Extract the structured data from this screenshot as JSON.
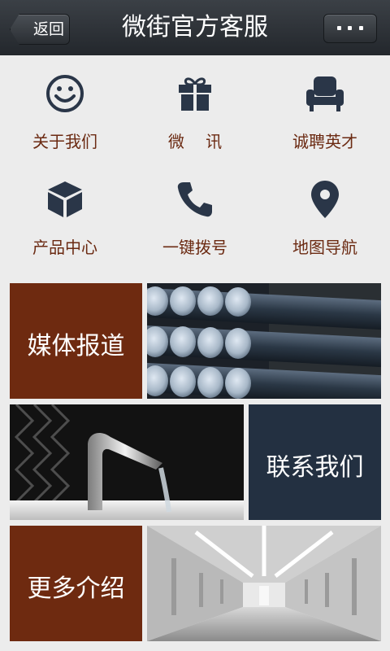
{
  "header": {
    "back_label": "返回",
    "title": "微街官方客服",
    "menu_icon": "more-dots-icon"
  },
  "grid": {
    "items": [
      {
        "label": "关于我们",
        "icon": "smiley-icon"
      },
      {
        "label": "微　 讯",
        "icon": "gift-icon"
      },
      {
        "label": "诚聘英才",
        "icon": "armchair-icon"
      },
      {
        "label": "产品中心",
        "icon": "cube-icon"
      },
      {
        "label": "一键拨号",
        "icon": "phone-icon"
      },
      {
        "label": "地图导航",
        "icon": "map-pin-icon"
      }
    ]
  },
  "tiles": {
    "media_label": "媒体报道",
    "contact_label": "联系我们",
    "more_label": "更多介绍"
  },
  "colors": {
    "header_bg": "#2b3035",
    "icon": "#2a3648",
    "label_text": "#6b2a12",
    "tile_brown": "#6e2a10",
    "tile_navy": "#233041",
    "page_bg": "#ececec"
  }
}
